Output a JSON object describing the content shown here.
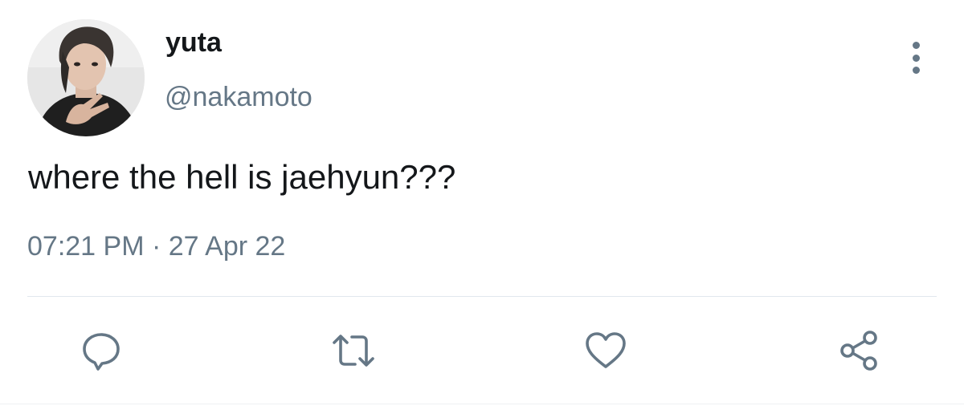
{
  "user": {
    "display_name": "yuta",
    "handle": "@nakamoto",
    "avatar": "profile-photo"
  },
  "tweet": {
    "text": "where the hell is jaehyun???",
    "time": "07:21 PM",
    "separator": "·",
    "date": "27 Apr 22"
  },
  "header": {
    "more_icon": "vertical-ellipsis-icon"
  },
  "actions": [
    {
      "name": "reply",
      "icon": "speech-bubble-icon"
    },
    {
      "name": "retweet",
      "icon": "retweet-arrows-icon"
    },
    {
      "name": "like",
      "icon": "heart-icon"
    },
    {
      "name": "share",
      "icon": "share-nodes-icon"
    }
  ],
  "colors": {
    "text_primary": "#14171a",
    "text_secondary": "#657786",
    "icon": "#657786",
    "divider": "#e1e8ed",
    "background": "#ffffff"
  }
}
